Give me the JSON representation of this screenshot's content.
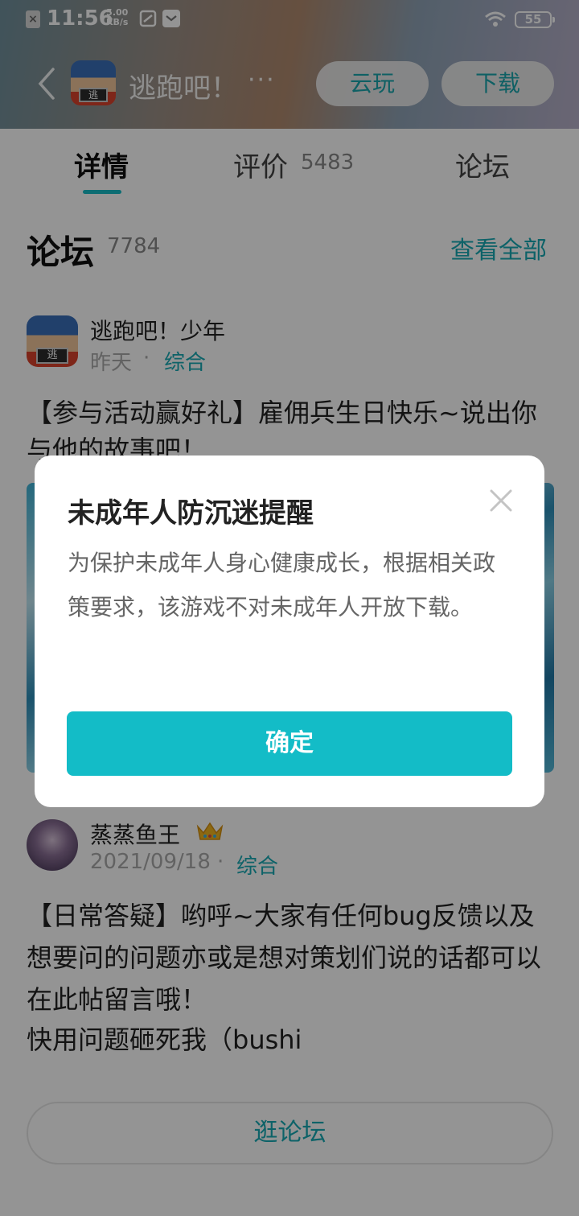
{
  "status_bar": {
    "time": "11:56",
    "speed_value": "5.00",
    "speed_unit": "KB/s",
    "battery": "55"
  },
  "header": {
    "app_title": "逃跑吧！",
    "more": "···",
    "cloud_play_label": "云玩",
    "download_label": "下载",
    "app_icon_text": "逃"
  },
  "tabs": [
    {
      "label": "详情",
      "active": true
    },
    {
      "label": "评价",
      "count": "5483"
    },
    {
      "label": "论坛"
    }
  ],
  "forum": {
    "title": "论坛",
    "count": "7784",
    "view_all": "查看全部",
    "posts": [
      {
        "author": "逃跑吧！少年",
        "date": "昨天",
        "separator": "·",
        "category": "综合",
        "avatar_text": "逃",
        "title": "【参与活动赢好礼】雇佣兵生日快乐~说出你与他的故事吧！"
      },
      {
        "author": "蒸蒸鱼王",
        "date": "2021/09/18",
        "separator": "·",
        "category": "综合",
        "body": "【日常答疑】哟呼~大家有任何bug反馈以及想要问的问题亦或是想对策划们说的话都可以在此帖留言哦！",
        "extra": "快用问题砸死我（bushi"
      }
    ],
    "browse_button": "逛论坛"
  },
  "modal": {
    "title": "未成年人防沉迷提醒",
    "body": "为保护未成年人身心健康成长，根据相关政策要求，该游戏不对未成年人开放下载。",
    "confirm_label": "确定"
  },
  "colors": {
    "accent": "#17aab3",
    "confirm_button": "#13bcc7"
  }
}
